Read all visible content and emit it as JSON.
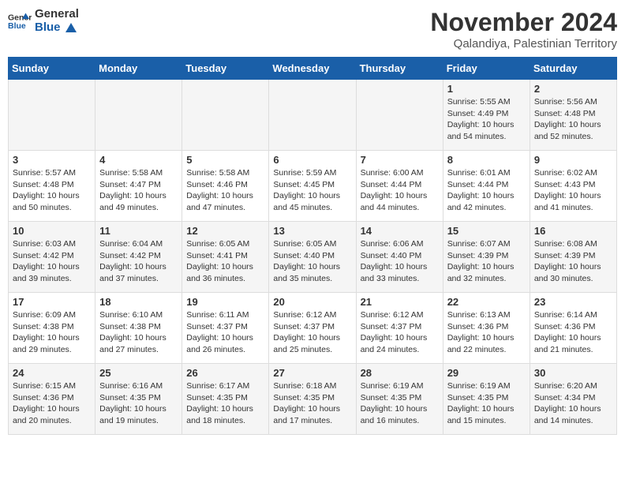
{
  "header": {
    "logo_general": "General",
    "logo_blue": "Blue",
    "title": "November 2024",
    "subtitle": "Qalandiya, Palestinian Territory"
  },
  "weekdays": [
    "Sunday",
    "Monday",
    "Tuesday",
    "Wednesday",
    "Thursday",
    "Friday",
    "Saturday"
  ],
  "weeks": [
    [
      {
        "day": "",
        "content": ""
      },
      {
        "day": "",
        "content": ""
      },
      {
        "day": "",
        "content": ""
      },
      {
        "day": "",
        "content": ""
      },
      {
        "day": "",
        "content": ""
      },
      {
        "day": "1",
        "content": "Sunrise: 5:55 AM\nSunset: 4:49 PM\nDaylight: 10 hours and 54 minutes."
      },
      {
        "day": "2",
        "content": "Sunrise: 5:56 AM\nSunset: 4:48 PM\nDaylight: 10 hours and 52 minutes."
      }
    ],
    [
      {
        "day": "3",
        "content": "Sunrise: 5:57 AM\nSunset: 4:48 PM\nDaylight: 10 hours and 50 minutes."
      },
      {
        "day": "4",
        "content": "Sunrise: 5:58 AM\nSunset: 4:47 PM\nDaylight: 10 hours and 49 minutes."
      },
      {
        "day": "5",
        "content": "Sunrise: 5:58 AM\nSunset: 4:46 PM\nDaylight: 10 hours and 47 minutes."
      },
      {
        "day": "6",
        "content": "Sunrise: 5:59 AM\nSunset: 4:45 PM\nDaylight: 10 hours and 45 minutes."
      },
      {
        "day": "7",
        "content": "Sunrise: 6:00 AM\nSunset: 4:44 PM\nDaylight: 10 hours and 44 minutes."
      },
      {
        "day": "8",
        "content": "Sunrise: 6:01 AM\nSunset: 4:44 PM\nDaylight: 10 hours and 42 minutes."
      },
      {
        "day": "9",
        "content": "Sunrise: 6:02 AM\nSunset: 4:43 PM\nDaylight: 10 hours and 41 minutes."
      }
    ],
    [
      {
        "day": "10",
        "content": "Sunrise: 6:03 AM\nSunset: 4:42 PM\nDaylight: 10 hours and 39 minutes."
      },
      {
        "day": "11",
        "content": "Sunrise: 6:04 AM\nSunset: 4:42 PM\nDaylight: 10 hours and 37 minutes."
      },
      {
        "day": "12",
        "content": "Sunrise: 6:05 AM\nSunset: 4:41 PM\nDaylight: 10 hours and 36 minutes."
      },
      {
        "day": "13",
        "content": "Sunrise: 6:05 AM\nSunset: 4:40 PM\nDaylight: 10 hours and 35 minutes."
      },
      {
        "day": "14",
        "content": "Sunrise: 6:06 AM\nSunset: 4:40 PM\nDaylight: 10 hours and 33 minutes."
      },
      {
        "day": "15",
        "content": "Sunrise: 6:07 AM\nSunset: 4:39 PM\nDaylight: 10 hours and 32 minutes."
      },
      {
        "day": "16",
        "content": "Sunrise: 6:08 AM\nSunset: 4:39 PM\nDaylight: 10 hours and 30 minutes."
      }
    ],
    [
      {
        "day": "17",
        "content": "Sunrise: 6:09 AM\nSunset: 4:38 PM\nDaylight: 10 hours and 29 minutes."
      },
      {
        "day": "18",
        "content": "Sunrise: 6:10 AM\nSunset: 4:38 PM\nDaylight: 10 hours and 27 minutes."
      },
      {
        "day": "19",
        "content": "Sunrise: 6:11 AM\nSunset: 4:37 PM\nDaylight: 10 hours and 26 minutes."
      },
      {
        "day": "20",
        "content": "Sunrise: 6:12 AM\nSunset: 4:37 PM\nDaylight: 10 hours and 25 minutes."
      },
      {
        "day": "21",
        "content": "Sunrise: 6:12 AM\nSunset: 4:37 PM\nDaylight: 10 hours and 24 minutes."
      },
      {
        "day": "22",
        "content": "Sunrise: 6:13 AM\nSunset: 4:36 PM\nDaylight: 10 hours and 22 minutes."
      },
      {
        "day": "23",
        "content": "Sunrise: 6:14 AM\nSunset: 4:36 PM\nDaylight: 10 hours and 21 minutes."
      }
    ],
    [
      {
        "day": "24",
        "content": "Sunrise: 6:15 AM\nSunset: 4:36 PM\nDaylight: 10 hours and 20 minutes."
      },
      {
        "day": "25",
        "content": "Sunrise: 6:16 AM\nSunset: 4:35 PM\nDaylight: 10 hours and 19 minutes."
      },
      {
        "day": "26",
        "content": "Sunrise: 6:17 AM\nSunset: 4:35 PM\nDaylight: 10 hours and 18 minutes."
      },
      {
        "day": "27",
        "content": "Sunrise: 6:18 AM\nSunset: 4:35 PM\nDaylight: 10 hours and 17 minutes."
      },
      {
        "day": "28",
        "content": "Sunrise: 6:19 AM\nSunset: 4:35 PM\nDaylight: 10 hours and 16 minutes."
      },
      {
        "day": "29",
        "content": "Sunrise: 6:19 AM\nSunset: 4:35 PM\nDaylight: 10 hours and 15 minutes."
      },
      {
        "day": "30",
        "content": "Sunrise: 6:20 AM\nSunset: 4:34 PM\nDaylight: 10 hours and 14 minutes."
      }
    ]
  ]
}
